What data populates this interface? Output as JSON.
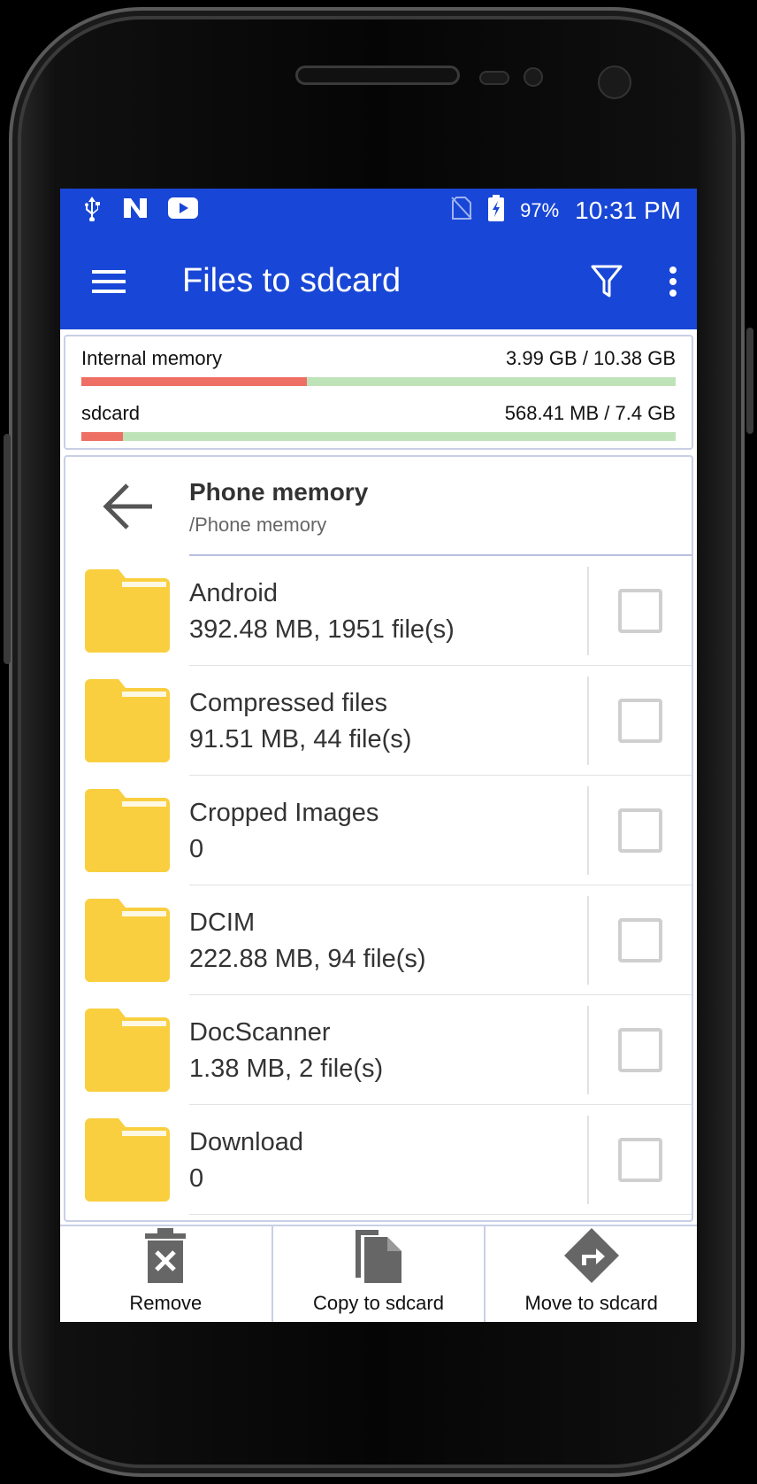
{
  "status": {
    "battery": "97%",
    "time": "10:31 PM"
  },
  "appbar": {
    "title": "Files to sdcard"
  },
  "memory": {
    "internal": {
      "label": "Internal memory",
      "value": "3.99 GB / 10.38 GB",
      "used_fraction": 0.38
    },
    "sdcard": {
      "label": "sdcard",
      "value": "568.41 MB / 7.4 GB",
      "used_fraction": 0.07
    }
  },
  "location": {
    "title": "Phone memory",
    "path": "/Phone memory"
  },
  "items": [
    {
      "name": "Android",
      "meta": "392.48 MB, 1951 file(s)"
    },
    {
      "name": "Compressed files",
      "meta": "91.51 MB, 44 file(s)"
    },
    {
      "name": "Cropped Images",
      "meta": "0"
    },
    {
      "name": "DCIM",
      "meta": "222.88 MB, 94 file(s)"
    },
    {
      "name": "DocScanner",
      "meta": "1.38 MB, 2 file(s)"
    },
    {
      "name": "Download",
      "meta": "0"
    }
  ],
  "actions": {
    "remove": "Remove",
    "copy": "Copy to sdcard",
    "move": "Move to sdcard"
  },
  "colors": {
    "primary": "#1846d6",
    "used": "#ee6f63",
    "free": "#bfe3b8",
    "folder": "#f9cf3f",
    "action_icon": "#666666"
  }
}
